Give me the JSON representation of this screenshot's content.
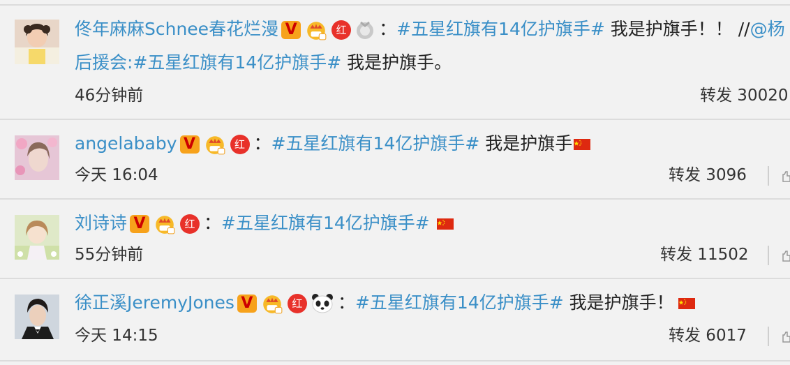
{
  "posts": [
    {
      "name": "佟年麻麻Schnee春花烂漫",
      "colon": "：",
      "topic": "#五星红旗有14亿护旗手#",
      "text": " 我是护旗手！！ //",
      "mention": "@杨",
      "continuation_name": "后援会:",
      "continuation_topic": "#五星红旗有14亿护旗手#",
      "continuation_text": " 我是护旗手。",
      "time": "46分钟前",
      "repost": "转发 30020",
      "vip_badge": "V",
      "hong_badge": "红",
      "extra_icon": "medal-icon"
    },
    {
      "name": "angelababy",
      "colon": "：",
      "topic": "#五星红旗有14亿护旗手#",
      "text": " 我是护旗手",
      "time": "今天 16:04",
      "repost": "转发 3096",
      "vip_badge": "V",
      "hong_badge": "红",
      "flag_icon": "china-flag-icon"
    },
    {
      "name": "刘诗诗",
      "colon": "：",
      "topic": "#五星红旗有14亿护旗手#",
      "text": " ",
      "time": "55分钟前",
      "repost": "转发 11502",
      "vip_badge": "V",
      "hong_badge": "红",
      "flag_icon": "china-flag-icon"
    },
    {
      "name": "徐正溪JeremyJones",
      "colon": "：",
      "topic": "#五星红旗有14亿护旗手#",
      "text": " 我是护旗手！",
      "time": "今天 14:15",
      "repost": "转发 6017",
      "vip_badge": "V",
      "hong_badge": "红",
      "extra_icon": "panda-icon",
      "flag_icon": "china-flag-icon"
    }
  ],
  "colors": {
    "link": "#3a8fc7",
    "background": "#f2f2f2",
    "vip_gold": "#f7a21b",
    "hong_red": "#e8312a"
  }
}
